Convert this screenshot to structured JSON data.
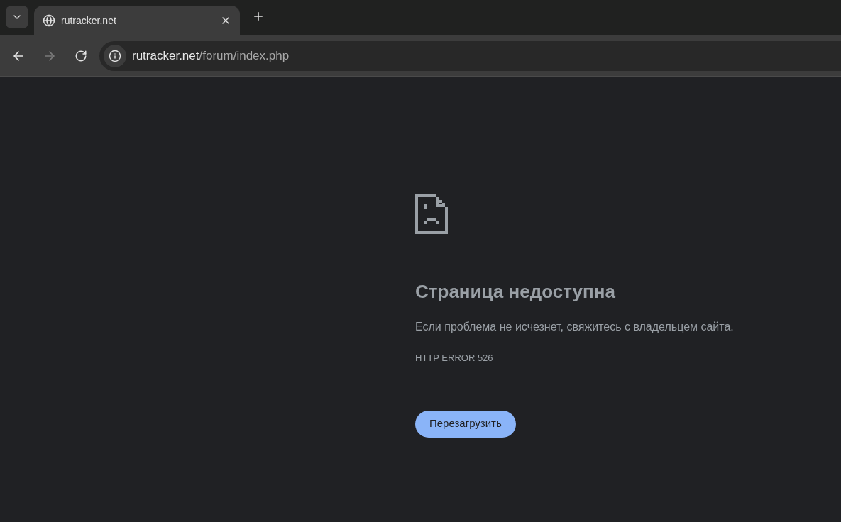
{
  "tabs": [
    {
      "title": "rutracker.net",
      "selected": true
    }
  ],
  "address_bar": {
    "host": "rutracker.net",
    "path": "/forum/index.php"
  },
  "error_page": {
    "heading": "Страница недоступна",
    "message": "Если проблема не исчезнет, свяжитесь с владельцем сайта.",
    "error_code": "HTTP ERROR 526",
    "reload_button": "Перезагрузить"
  }
}
